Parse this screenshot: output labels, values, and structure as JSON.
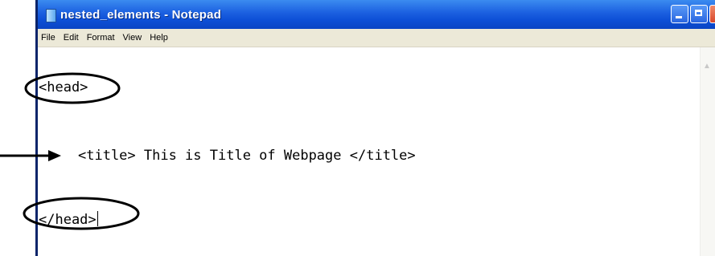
{
  "window": {
    "title": "nested_elements - Notepad",
    "buttons": {
      "minimize": "minimize-icon",
      "maximize": "maximize-icon",
      "close": "close-icon"
    }
  },
  "menu": {
    "items": [
      "File",
      "Edit",
      "Format",
      "View",
      "Help"
    ]
  },
  "editor": {
    "lines": [
      "<head>",
      "<title> This is Title of Webpage </title>",
      "</head>"
    ]
  },
  "colors": {
    "titlebar": "#0d4fd6",
    "menubar": "#ece9d8",
    "close_button": "#d8462a",
    "annotation": "#000000"
  }
}
